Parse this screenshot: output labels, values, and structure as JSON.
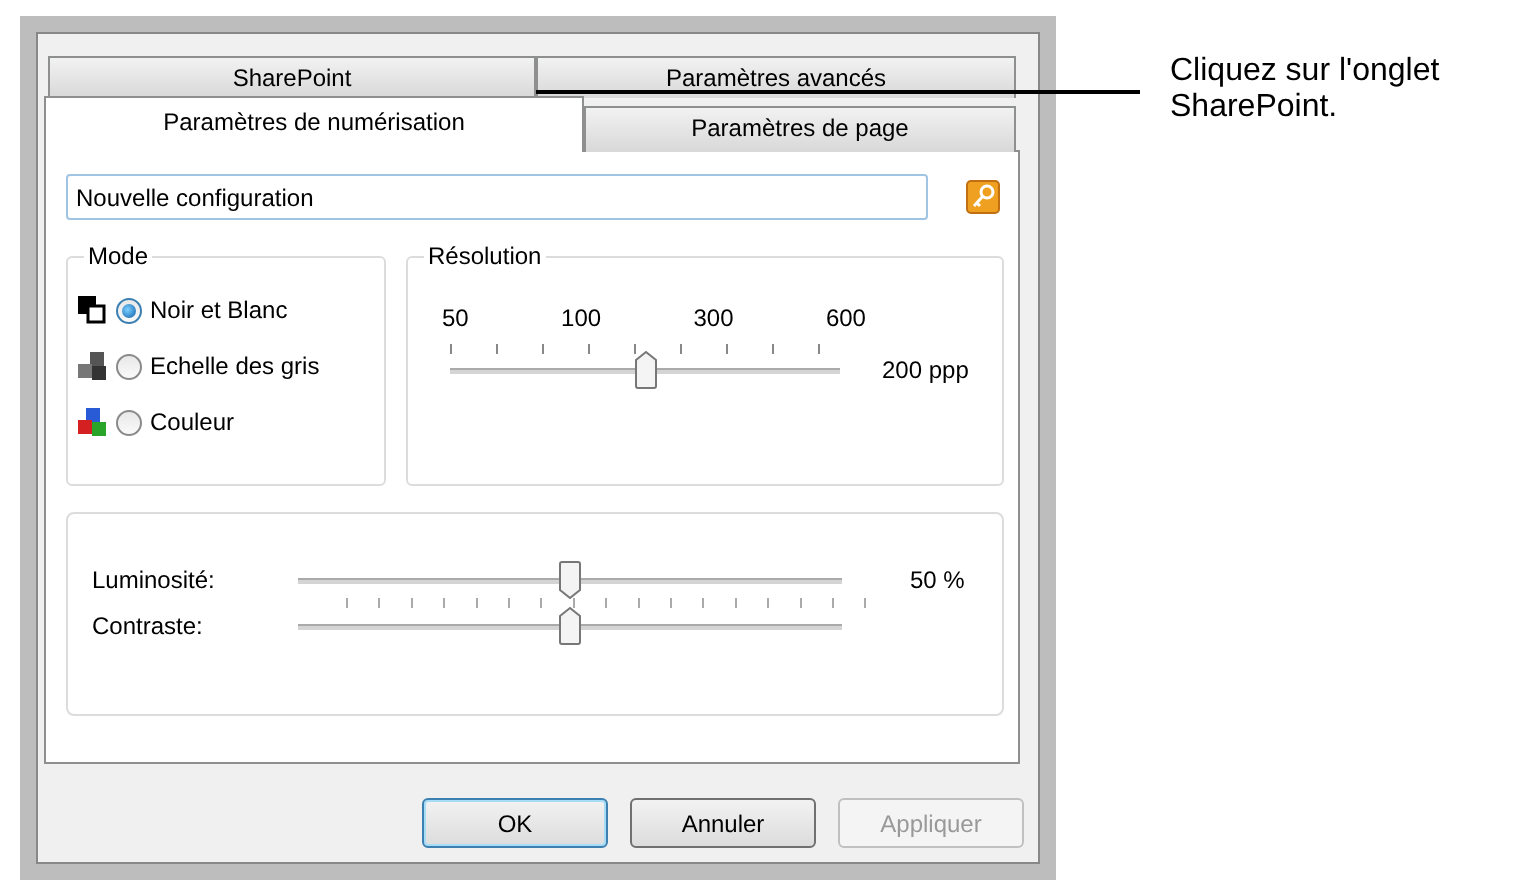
{
  "tab_rows": [
    [
      {
        "label": "SharePoint",
        "selected": false
      },
      {
        "label": "Paramètres avancés",
        "selected": false
      }
    ],
    [
      {
        "label": "Paramètres de numérisation",
        "selected": true
      },
      {
        "label": "Paramètres de page",
        "selected": false
      }
    ]
  ],
  "configuration": {
    "value": "Nouvelle configuration"
  },
  "mode": {
    "title": "Mode",
    "options": [
      {
        "label": "Noir et Blanc",
        "kind": "bw",
        "selected": true
      },
      {
        "label": "Echelle des gris",
        "kind": "gray",
        "selected": false
      },
      {
        "label": "Couleur",
        "kind": "color",
        "selected": false
      }
    ]
  },
  "resolution": {
    "title": "Résolution",
    "scale": [
      "50",
      "100",
      "300",
      "600"
    ],
    "level": 0.5,
    "reading": "200 ppp"
  },
  "adjustments": [
    {
      "label": "Luminosité:",
      "level": 0.5,
      "reading": "50 %"
    },
    {
      "label": "Contraste:",
      "level": 0.5
    }
  ],
  "buttons": [
    {
      "label": "OK",
      "default": true,
      "disabled": false
    },
    {
      "label": "Annuler",
      "default": false,
      "disabled": false
    },
    {
      "label": "Appliquer",
      "default": false,
      "disabled": true
    }
  ],
  "callout": {
    "text": "Cliquez sur l'onglet SharePoint."
  }
}
